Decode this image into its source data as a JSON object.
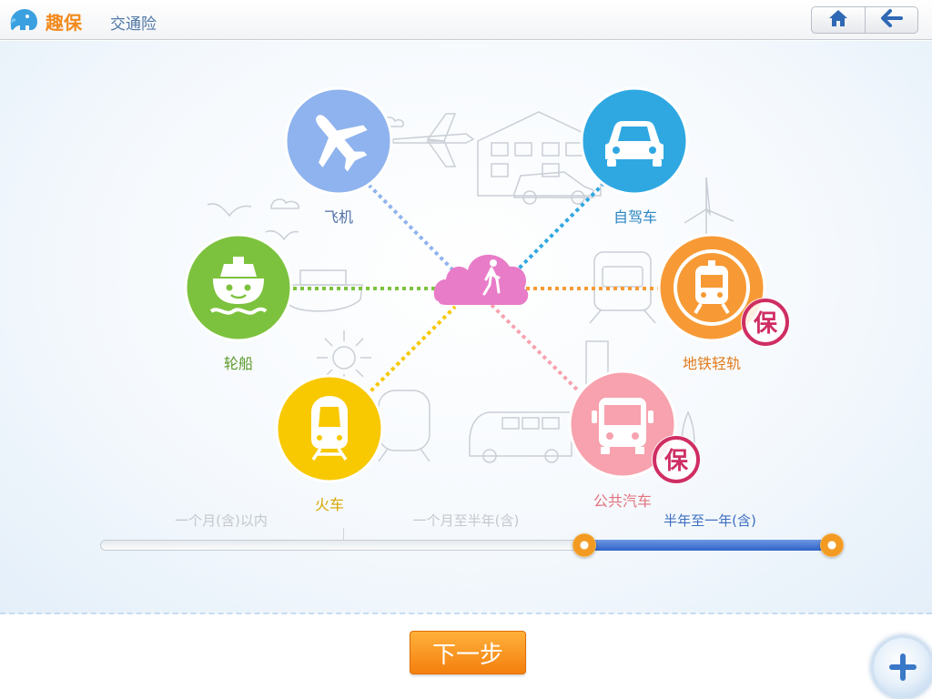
{
  "app": {
    "brand_name": "趣保",
    "page_title": "交通险"
  },
  "nav": {
    "home_icon": "home-icon",
    "back_icon": "back-arrow-icon"
  },
  "colors": {
    "brand_orange": "#f28a1e",
    "title_blue": "#4f78a6",
    "hub_pink": "#e87cc8"
  },
  "transport": [
    {
      "id": "plane",
      "label": "飞机",
      "icon": "airplane-icon",
      "color": "#8fb3ee",
      "label_color": "#4f6fa6",
      "insured": false
    },
    {
      "id": "car",
      "label": "自驾车",
      "icon": "car-icon",
      "color": "#2fa8e2",
      "label_color": "#2a86c3",
      "insured": false
    },
    {
      "id": "ship",
      "label": "轮船",
      "icon": "ship-icon",
      "color": "#7dc23e",
      "label_color": "#5a9a2a",
      "insured": false
    },
    {
      "id": "metro",
      "label": "地铁轻轨",
      "icon": "metro-icon",
      "color": "#f79a35",
      "label_color": "#e27a1a",
      "insured": true
    },
    {
      "id": "train",
      "label": "火车",
      "icon": "train-icon",
      "color": "#f8c800",
      "label_color": "#d9a600",
      "insured": false
    },
    {
      "id": "bus",
      "label": "公共汽车",
      "icon": "bus-icon",
      "color": "#f7a2ae",
      "label_color": "#e2737f",
      "insured": true
    }
  ],
  "insured_stamp": {
    "text": "保",
    "color": "#cf2e63"
  },
  "duration": {
    "options": [
      "一个月(含)以内",
      "一个月至半年(含)",
      "半年至一年(含)"
    ],
    "selected_index": 2,
    "range_start_fraction": 0.658,
    "range_end_fraction": 1.0
  },
  "actions": {
    "next_label": "下一步",
    "add_icon": "plus-icon"
  }
}
